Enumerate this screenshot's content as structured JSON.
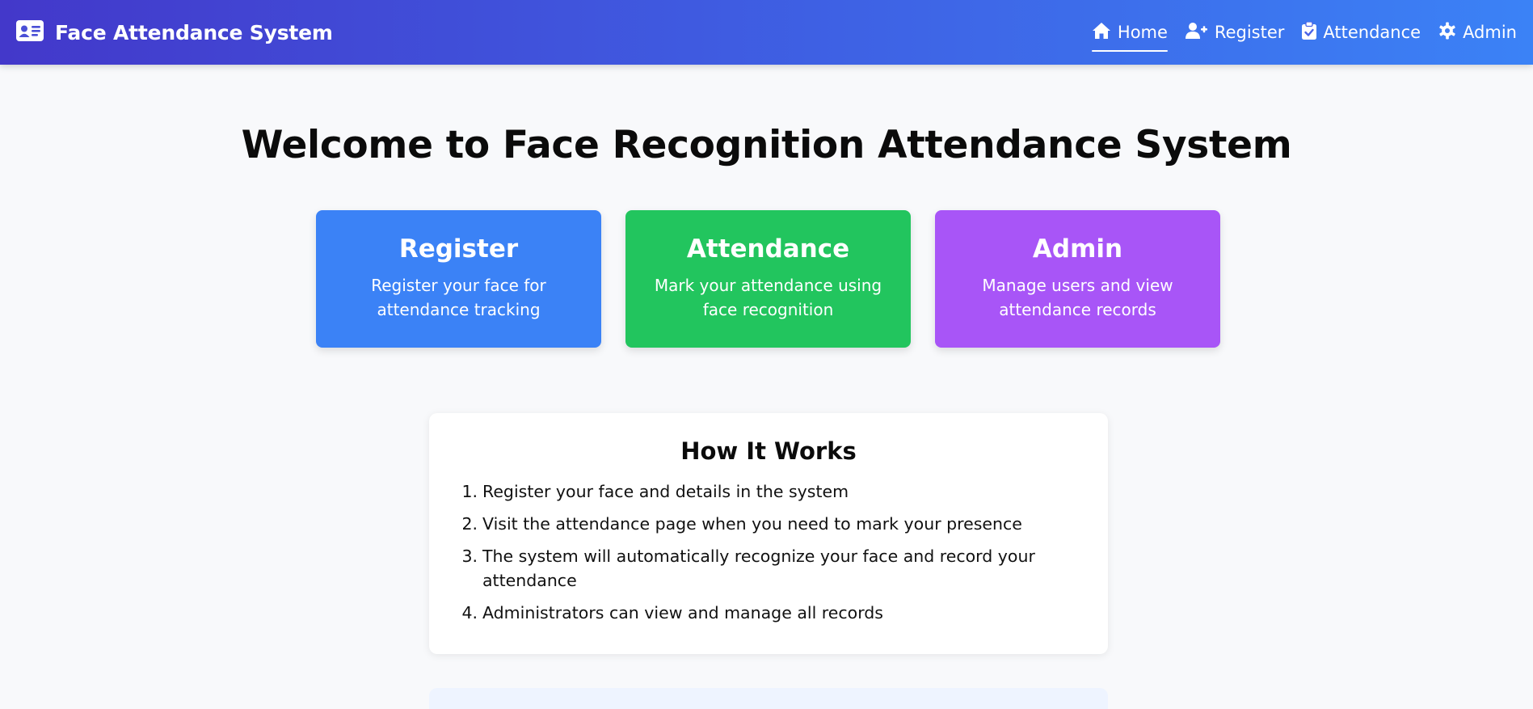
{
  "navbar": {
    "brand": "Face Attendance System",
    "brand_icon": "id-card-icon",
    "links": [
      {
        "label": "Home",
        "icon": "home-icon",
        "active": true
      },
      {
        "label": "Register",
        "icon": "user-plus-icon",
        "active": false
      },
      {
        "label": "Attendance",
        "icon": "clipboard-check-icon",
        "active": false
      },
      {
        "label": "Admin",
        "icon": "gear-icon",
        "active": false
      }
    ]
  },
  "main": {
    "title": "Welcome to Face Recognition Attendance System",
    "cards": [
      {
        "title": "Register",
        "description": "Register your face for attendance tracking",
        "color": "#3b82f6"
      },
      {
        "title": "Attendance",
        "description": "Mark your attendance using face recognition",
        "color": "#22c55e"
      },
      {
        "title": "Admin",
        "description": "Manage users and view attendance records",
        "color": "#a855f7"
      }
    ],
    "how_it_works": {
      "title": "How It Works",
      "steps": [
        {
          "num": "1.",
          "text": "Register your face and details in the system"
        },
        {
          "num": "2.",
          "text": "Visit the attendance page when you need to mark your presence"
        },
        {
          "num": "3.",
          "text": "The system will automatically recognize your face and record your attendance"
        },
        {
          "num": "4.",
          "text": "Administrators can view and manage all records"
        }
      ]
    }
  },
  "colors": {
    "nav_gradient_start": "#4338ca",
    "nav_gradient_end": "#3b82f6",
    "page_background": "#f8f9fb"
  }
}
